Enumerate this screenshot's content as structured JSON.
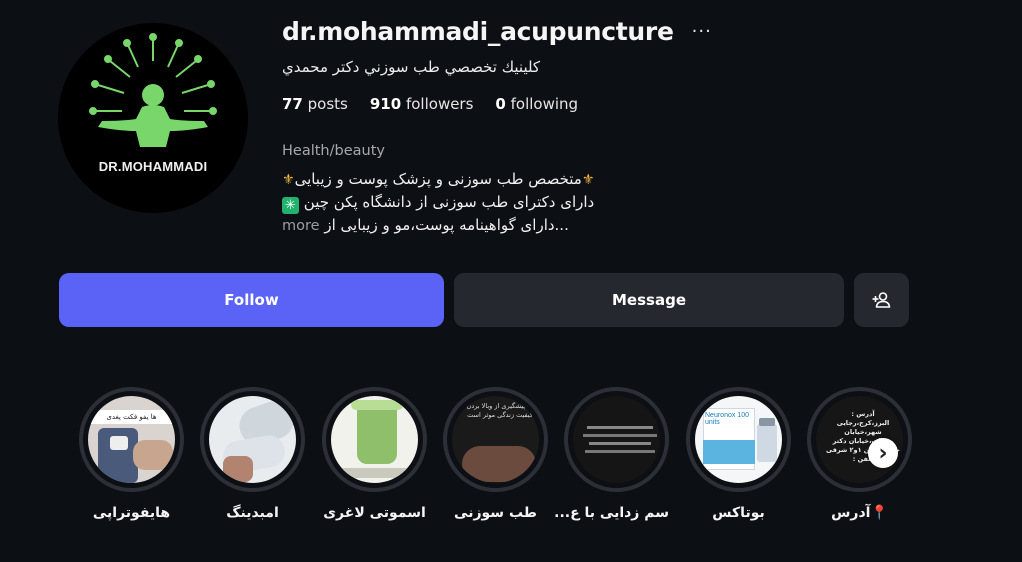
{
  "profile": {
    "username": "dr.mohammadi_acupuncture",
    "more_icon": "more-horizontal-icon",
    "full_name": "كلينيك تخصصي طب سوزني دكتر محمدي",
    "avatar_text": "DR.MOHAMMADI",
    "posts_count": "77",
    "posts_label": "posts",
    "followers_count": "910",
    "followers_label": "followers",
    "following_count": "0",
    "following_label": "following",
    "category": "Health/beauty",
    "bio_line1": "متخصص طب سوزنی و پزشک پوست و زیبایی",
    "bio_line2": "دارای دکترای طب سوزنی از دانشگاه پکن چین",
    "bio_line3": "...دارای گواهینامه پوست،مو و زیبایی از",
    "bio_more": "more",
    "colors": {
      "follow": "#5b63f6",
      "background": "#0c0f14",
      "logo_green": "#78d66b"
    }
  },
  "actions": {
    "follow_label": "Follow",
    "message_label": "Message",
    "add_user_icon": "add-user-icon"
  },
  "highlights": [
    {
      "label": "هایفوتراپی",
      "img_text": "ها یفو فکت پغدی"
    },
    {
      "label": "امبدینگ",
      "img_text": ""
    },
    {
      "label": "اسموتی لاغری",
      "img_text": ""
    },
    {
      "label": "طب سوزنی",
      "img_text": "... پیشگیری از وبالا بردن کیفیت زندگی موثر است"
    },
    {
      "label": "سم زدایی با ع...",
      "img_text": ""
    },
    {
      "label": "بوتاکس",
      "img_text": "Neuronox 100 units"
    },
    {
      "label": "📍آدرس",
      "img_text": "آدرس : البرز،کرج،رجایی شهر،خیابان رسالت،خیابان دکتر حسابی،بین ۱و۲ شرقی تلفن :"
    }
  ],
  "carousel": {
    "next_icon": "chevron-right-icon"
  }
}
